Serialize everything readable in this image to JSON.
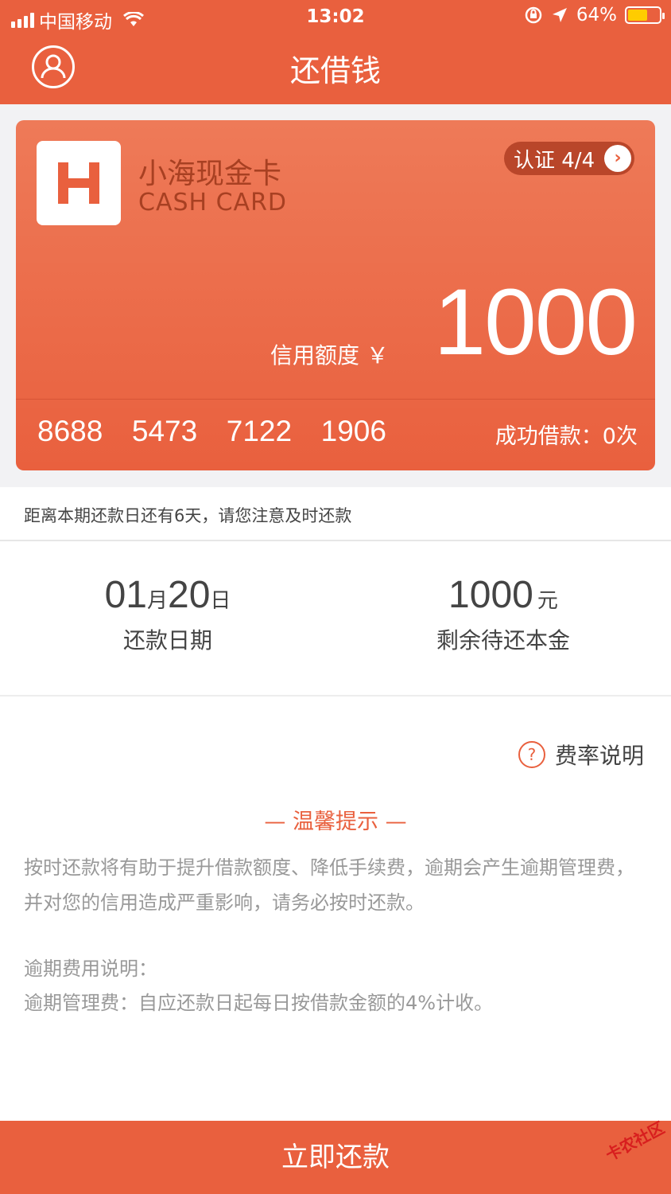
{
  "status_bar": {
    "carrier": "中国移动",
    "time": "13:02",
    "battery": "64%",
    "battery_level": 0.64
  },
  "nav": {
    "title": "还借钱"
  },
  "card": {
    "name": "小海现金卡",
    "subtitle": "CASH CARD",
    "verify_label": "认证 4/4",
    "credit_label": "信用额度 ￥",
    "credit_amount": "1000",
    "card_number": "8688  5473  7122  1906",
    "loan_count": "成功借款：0次"
  },
  "notice": "距离本期还款日还有6天，请您注意及时还款",
  "stats": {
    "due_date_month": "01",
    "due_date_month_unit": "月",
    "due_date_day": "20",
    "due_date_day_unit": "日",
    "due_date_label": "还款日期",
    "principal_value": "1000",
    "principal_unit": "元",
    "principal_label": "剩余待还本金"
  },
  "fee_link": "费率说明",
  "tips": {
    "title": "— 温馨提示 —",
    "body": "按时还款将有助于提升借款额度、降低手续费，逾期会产生逾期管理费，并对您的信用造成严重影响，请务必按时还款。",
    "fee_title": "逾期费用说明：",
    "fee_detail": "逾期管理费：自应还款日起每日按借款金额的4%计收。"
  },
  "repay_button": "立即还款",
  "watermark": "卡农社区",
  "colors": {
    "brand": "#E9603E"
  }
}
